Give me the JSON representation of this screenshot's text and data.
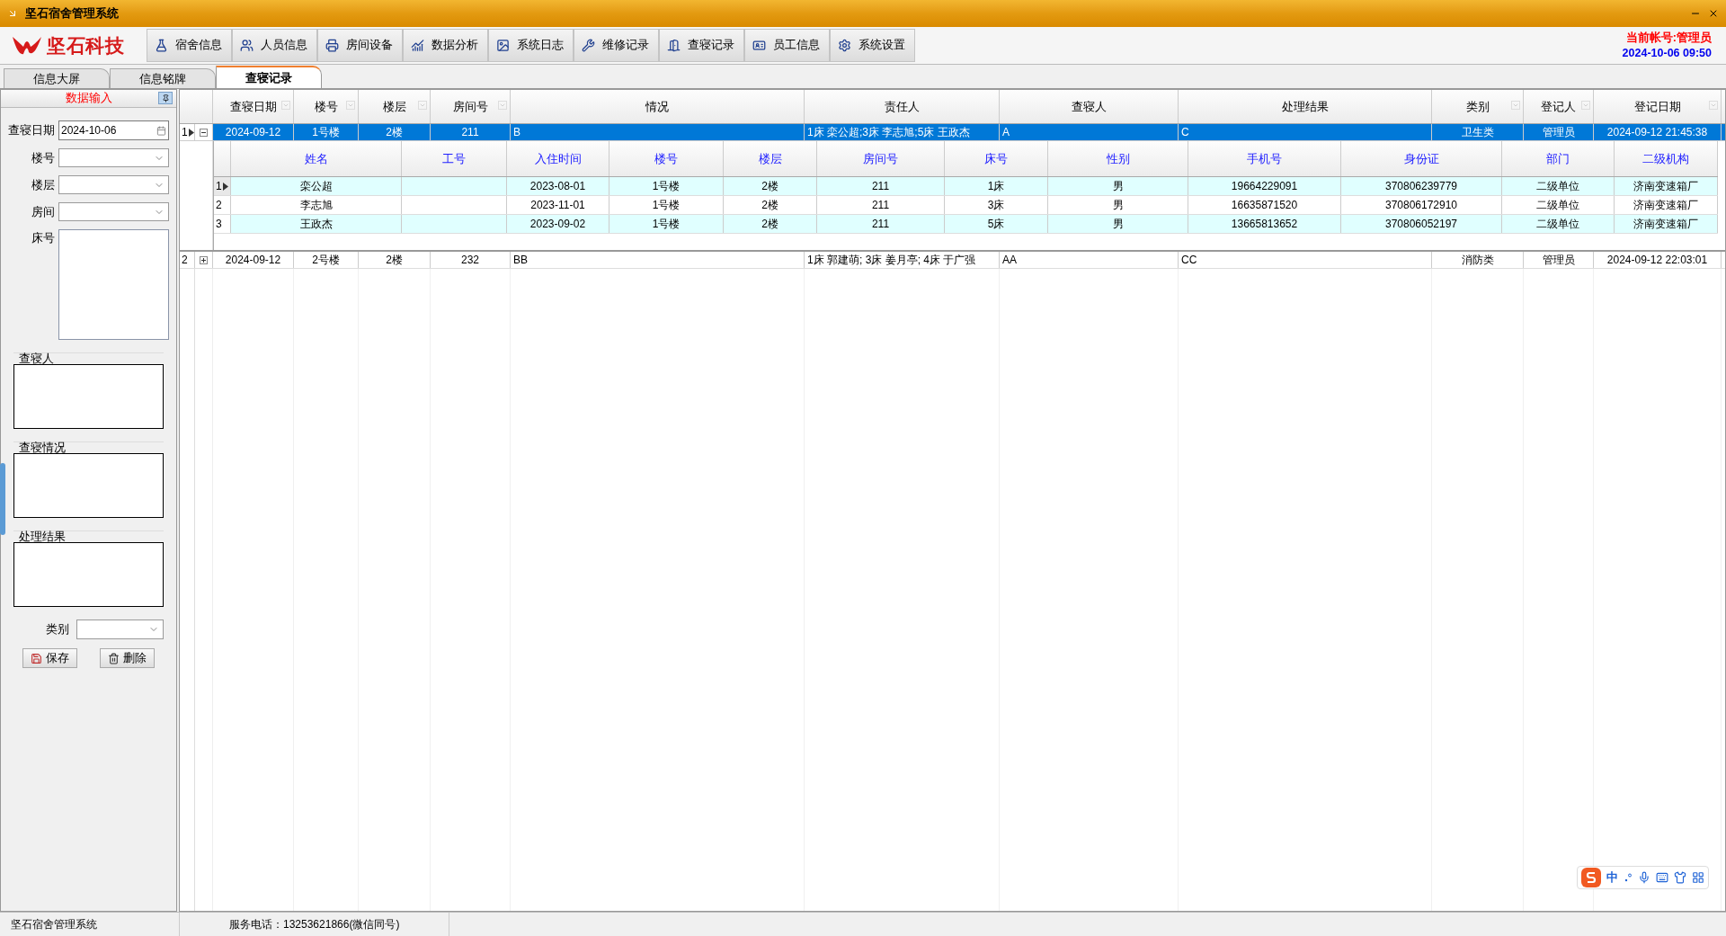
{
  "window": {
    "title": "坚石宿舍管理系统"
  },
  "logo": {
    "text": "坚石科技"
  },
  "toolbar": [
    {
      "label": "宿舍信息"
    },
    {
      "label": "人员信息"
    },
    {
      "label": "房间设备"
    },
    {
      "label": "数据分析"
    },
    {
      "label": "系统日志"
    },
    {
      "label": "维修记录"
    },
    {
      "label": "查寝记录"
    },
    {
      "label": "员工信息"
    },
    {
      "label": "系统设置"
    }
  ],
  "account": {
    "user": "当前帐号:管理员",
    "datetime": "2024-10-06 09:50"
  },
  "tabs": [
    {
      "label": "信息大屏",
      "selected": false
    },
    {
      "label": "信息铭牌",
      "selected": false
    },
    {
      "label": "查寝记录",
      "selected": true
    }
  ],
  "input_panel": {
    "title": "数据输入",
    "date_label": "查寝日期",
    "date_value": "2024-10-06",
    "selects": [
      {
        "label": "楼号"
      },
      {
        "label": "楼层"
      },
      {
        "label": "房间"
      }
    ],
    "bed_label": "床号",
    "groups": [
      {
        "label": "查寝人"
      },
      {
        "label": "查寝情况"
      },
      {
        "label": "处理结果"
      }
    ],
    "category_label": "类别",
    "buttons": [
      {
        "label": "保存"
      },
      {
        "label": "删除"
      }
    ]
  },
  "grid": {
    "columns": [
      {
        "label": "查寝日期",
        "filter": true
      },
      {
        "label": "楼号",
        "filter": true
      },
      {
        "label": "楼层",
        "filter": true
      },
      {
        "label": "房间号",
        "filter": true
      },
      {
        "label": "情况",
        "filter": false
      },
      {
        "label": "责任人",
        "filter": false
      },
      {
        "label": "查寝人",
        "filter": false
      },
      {
        "label": "处理结果",
        "filter": false
      },
      {
        "label": "类别",
        "filter": true
      },
      {
        "label": "登记人",
        "filter": true
      },
      {
        "label": "登记日期",
        "filter": true
      }
    ],
    "rows": [
      {
        "index": "1",
        "selected": true,
        "expanded": true,
        "cells": [
          "2024-09-12",
          "1号楼",
          "2楼",
          "211",
          "B",
          "1床 栾公超;3床 李志旭;5床 王政杰",
          "A",
          "C",
          "卫生类",
          "管理员",
          "2024-09-12 21:45:38"
        ],
        "detail": {
          "columns": [
            "姓名",
            "工号",
            "入住时间",
            "楼号",
            "楼层",
            "房间号",
            "床号",
            "性别",
            "手机号",
            "身份证",
            "部门",
            "二级机构"
          ],
          "rows": [
            {
              "index": "1",
              "selected": true,
              "cells": [
                "栾公超",
                "",
                "2023-08-01",
                "1号楼",
                "2楼",
                "211",
                "1床",
                "男",
                "19664229091",
                "370806239779",
                "二级单位",
                "济南变速箱厂"
              ]
            },
            {
              "index": "2",
              "selected": false,
              "cells": [
                "李志旭",
                "",
                "2023-11-01",
                "1号楼",
                "2楼",
                "211",
                "3床",
                "男",
                "16635871520",
                "370806172910",
                "二级单位",
                "济南变速箱厂"
              ]
            },
            {
              "index": "3",
              "selected": false,
              "cells": [
                "王政杰",
                "",
                "2023-09-02",
                "1号楼",
                "2楼",
                "211",
                "5床",
                "男",
                "13665813652",
                "370806052197",
                "二级单位",
                "济南变速箱厂"
              ]
            }
          ]
        }
      },
      {
        "index": "2",
        "selected": false,
        "expanded": false,
        "cells": [
          "2024-09-12",
          "2号楼",
          "2楼",
          "232",
          "BB",
          "1床 郭建萌; 3床 姜月亭; 4床 于广强",
          "AA",
          "CC",
          "消防类",
          "管理员",
          "2024-09-12 22:03:01"
        ]
      }
    ]
  },
  "ime_toolbar": {
    "mode": "中"
  },
  "status_bar": [
    "坚石宿舍管理系统",
    "服务电话：13253621866(微信同号)"
  ]
}
